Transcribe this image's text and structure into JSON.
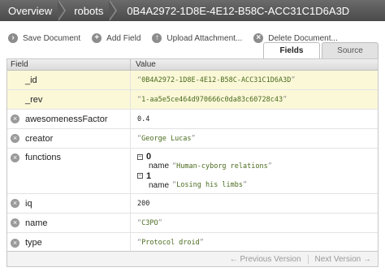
{
  "breadcrumb": {
    "items": [
      "Overview",
      "robots"
    ],
    "current": "0B4A2972-1D8E-4E12-B58C-ACC31C1D6A3D"
  },
  "toolbar": {
    "save": "Save Document",
    "add_field": "Add Field",
    "upload": "Upload Attachment...",
    "delete": "Delete Document..."
  },
  "tabs": {
    "fields": "Fields",
    "source": "Source"
  },
  "table": {
    "header_field": "Field",
    "header_value": "Value",
    "rows": {
      "id": {
        "field": "_id",
        "value": "0B4A2972-1D8E-4E12-B58C-ACC31C1D6A3D"
      },
      "rev": {
        "field": "_rev",
        "value": "1-aa5e5ce464d970666c0da83c60728c43"
      },
      "awesomeness": {
        "field": "awesomenessFactor",
        "value": "0.4"
      },
      "creator": {
        "field": "creator",
        "value": "George Lucas"
      },
      "functions": {
        "field": "functions",
        "items": [
          {
            "index": "0",
            "key": "name",
            "value": "Human-cyborg relations"
          },
          {
            "index": "1",
            "key": "name",
            "value": "Losing his limbs"
          }
        ]
      },
      "iq": {
        "field": "iq",
        "value": "200"
      },
      "name": {
        "field": "name",
        "value": "C3PO"
      },
      "type": {
        "field": "type",
        "value": "Protocol droid"
      }
    }
  },
  "footer": {
    "prev": "← Previous Version",
    "next": "Next Version →"
  }
}
